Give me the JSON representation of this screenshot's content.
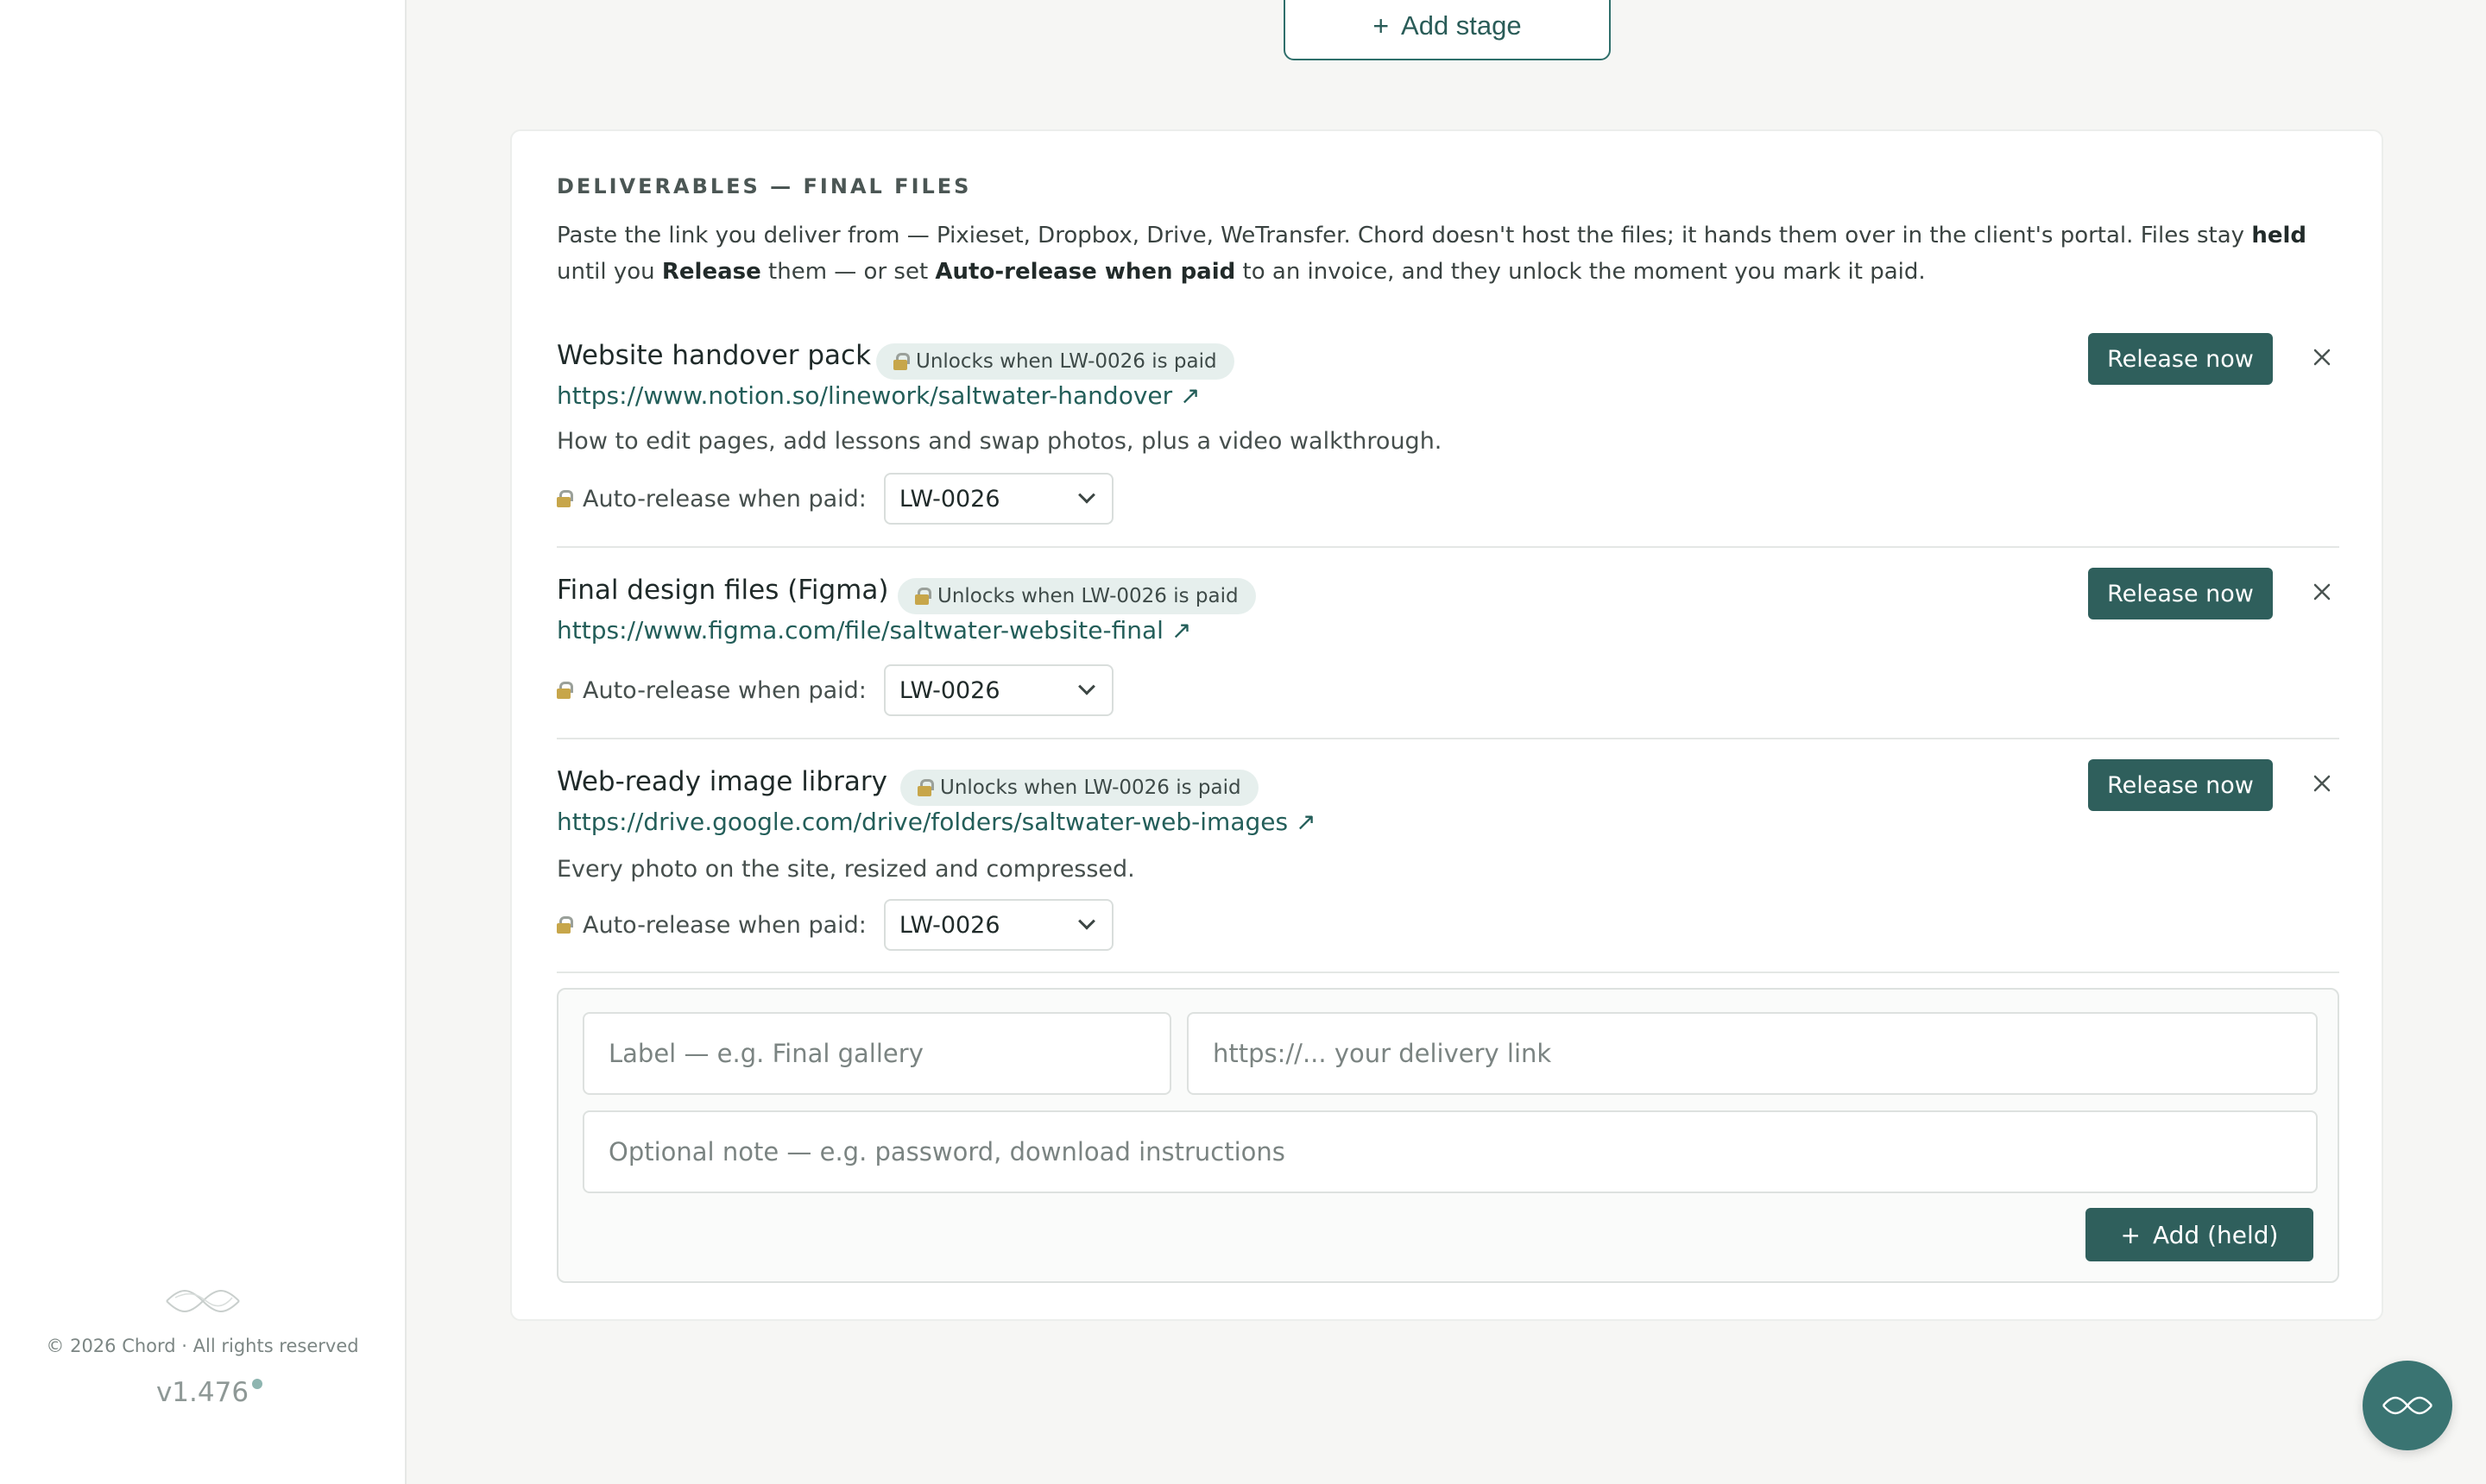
{
  "sidebar": {
    "copyright": "© 2026 Chord · All rights reserved",
    "version": "v1.476"
  },
  "toolbar": {
    "add_stage_label": "Add stage"
  },
  "deliverables": {
    "title": "DELIVERABLES — FINAL FILES",
    "desc_1": "Paste the link you deliver from — Pixieset, Dropbox, Drive, WeTransfer. Chord doesn't host the files; it hands them over in the client's portal. Files stay ",
    "desc_bold_1": "held",
    "desc_2": " until you ",
    "desc_bold_2": "Release",
    "desc_3": " them — or set ",
    "desc_bold_3": "Auto-release when paid",
    "desc_4": " to an invoice, and they unlock the moment you mark it paid.",
    "items": [
      {
        "title": "Website handover pack",
        "badge": "Unlocks when LW-0026 is paid",
        "link": "https://www.notion.so/linework/saltwater-handover ↗",
        "note": "How to edit pages, add lessons and swap photos, plus a video walkthrough.",
        "auto_label": "Auto-release when paid:",
        "invoice": "LW-0026",
        "release_label": "Release now"
      },
      {
        "title": "Final design files (Figma)",
        "badge": "Unlocks when LW-0026 is paid",
        "link": "https://www.figma.com/file/saltwater-website-final ↗",
        "note": "",
        "auto_label": "Auto-release when paid:",
        "invoice": "LW-0026",
        "release_label": "Release now"
      },
      {
        "title": "Web-ready image library",
        "badge": "Unlocks when LW-0026 is paid",
        "link": "https://drive.google.com/drive/folders/saltwater-web-images ↗",
        "note": "Every photo on the site, resized and compressed.",
        "auto_label": "Auto-release when paid:",
        "invoice": "LW-0026",
        "release_label": "Release now"
      }
    ],
    "form": {
      "label_placeholder": "Label — e.g. Final gallery",
      "url_placeholder": "https://... your delivery link",
      "note_placeholder": "Optional note — e.g. password, download instructions",
      "add_label": "Add (held)"
    }
  },
  "colors": {
    "accent": "#2f5f5c",
    "link": "#235e59",
    "badge_bg": "#e6efed",
    "fab": "#3a7472"
  }
}
